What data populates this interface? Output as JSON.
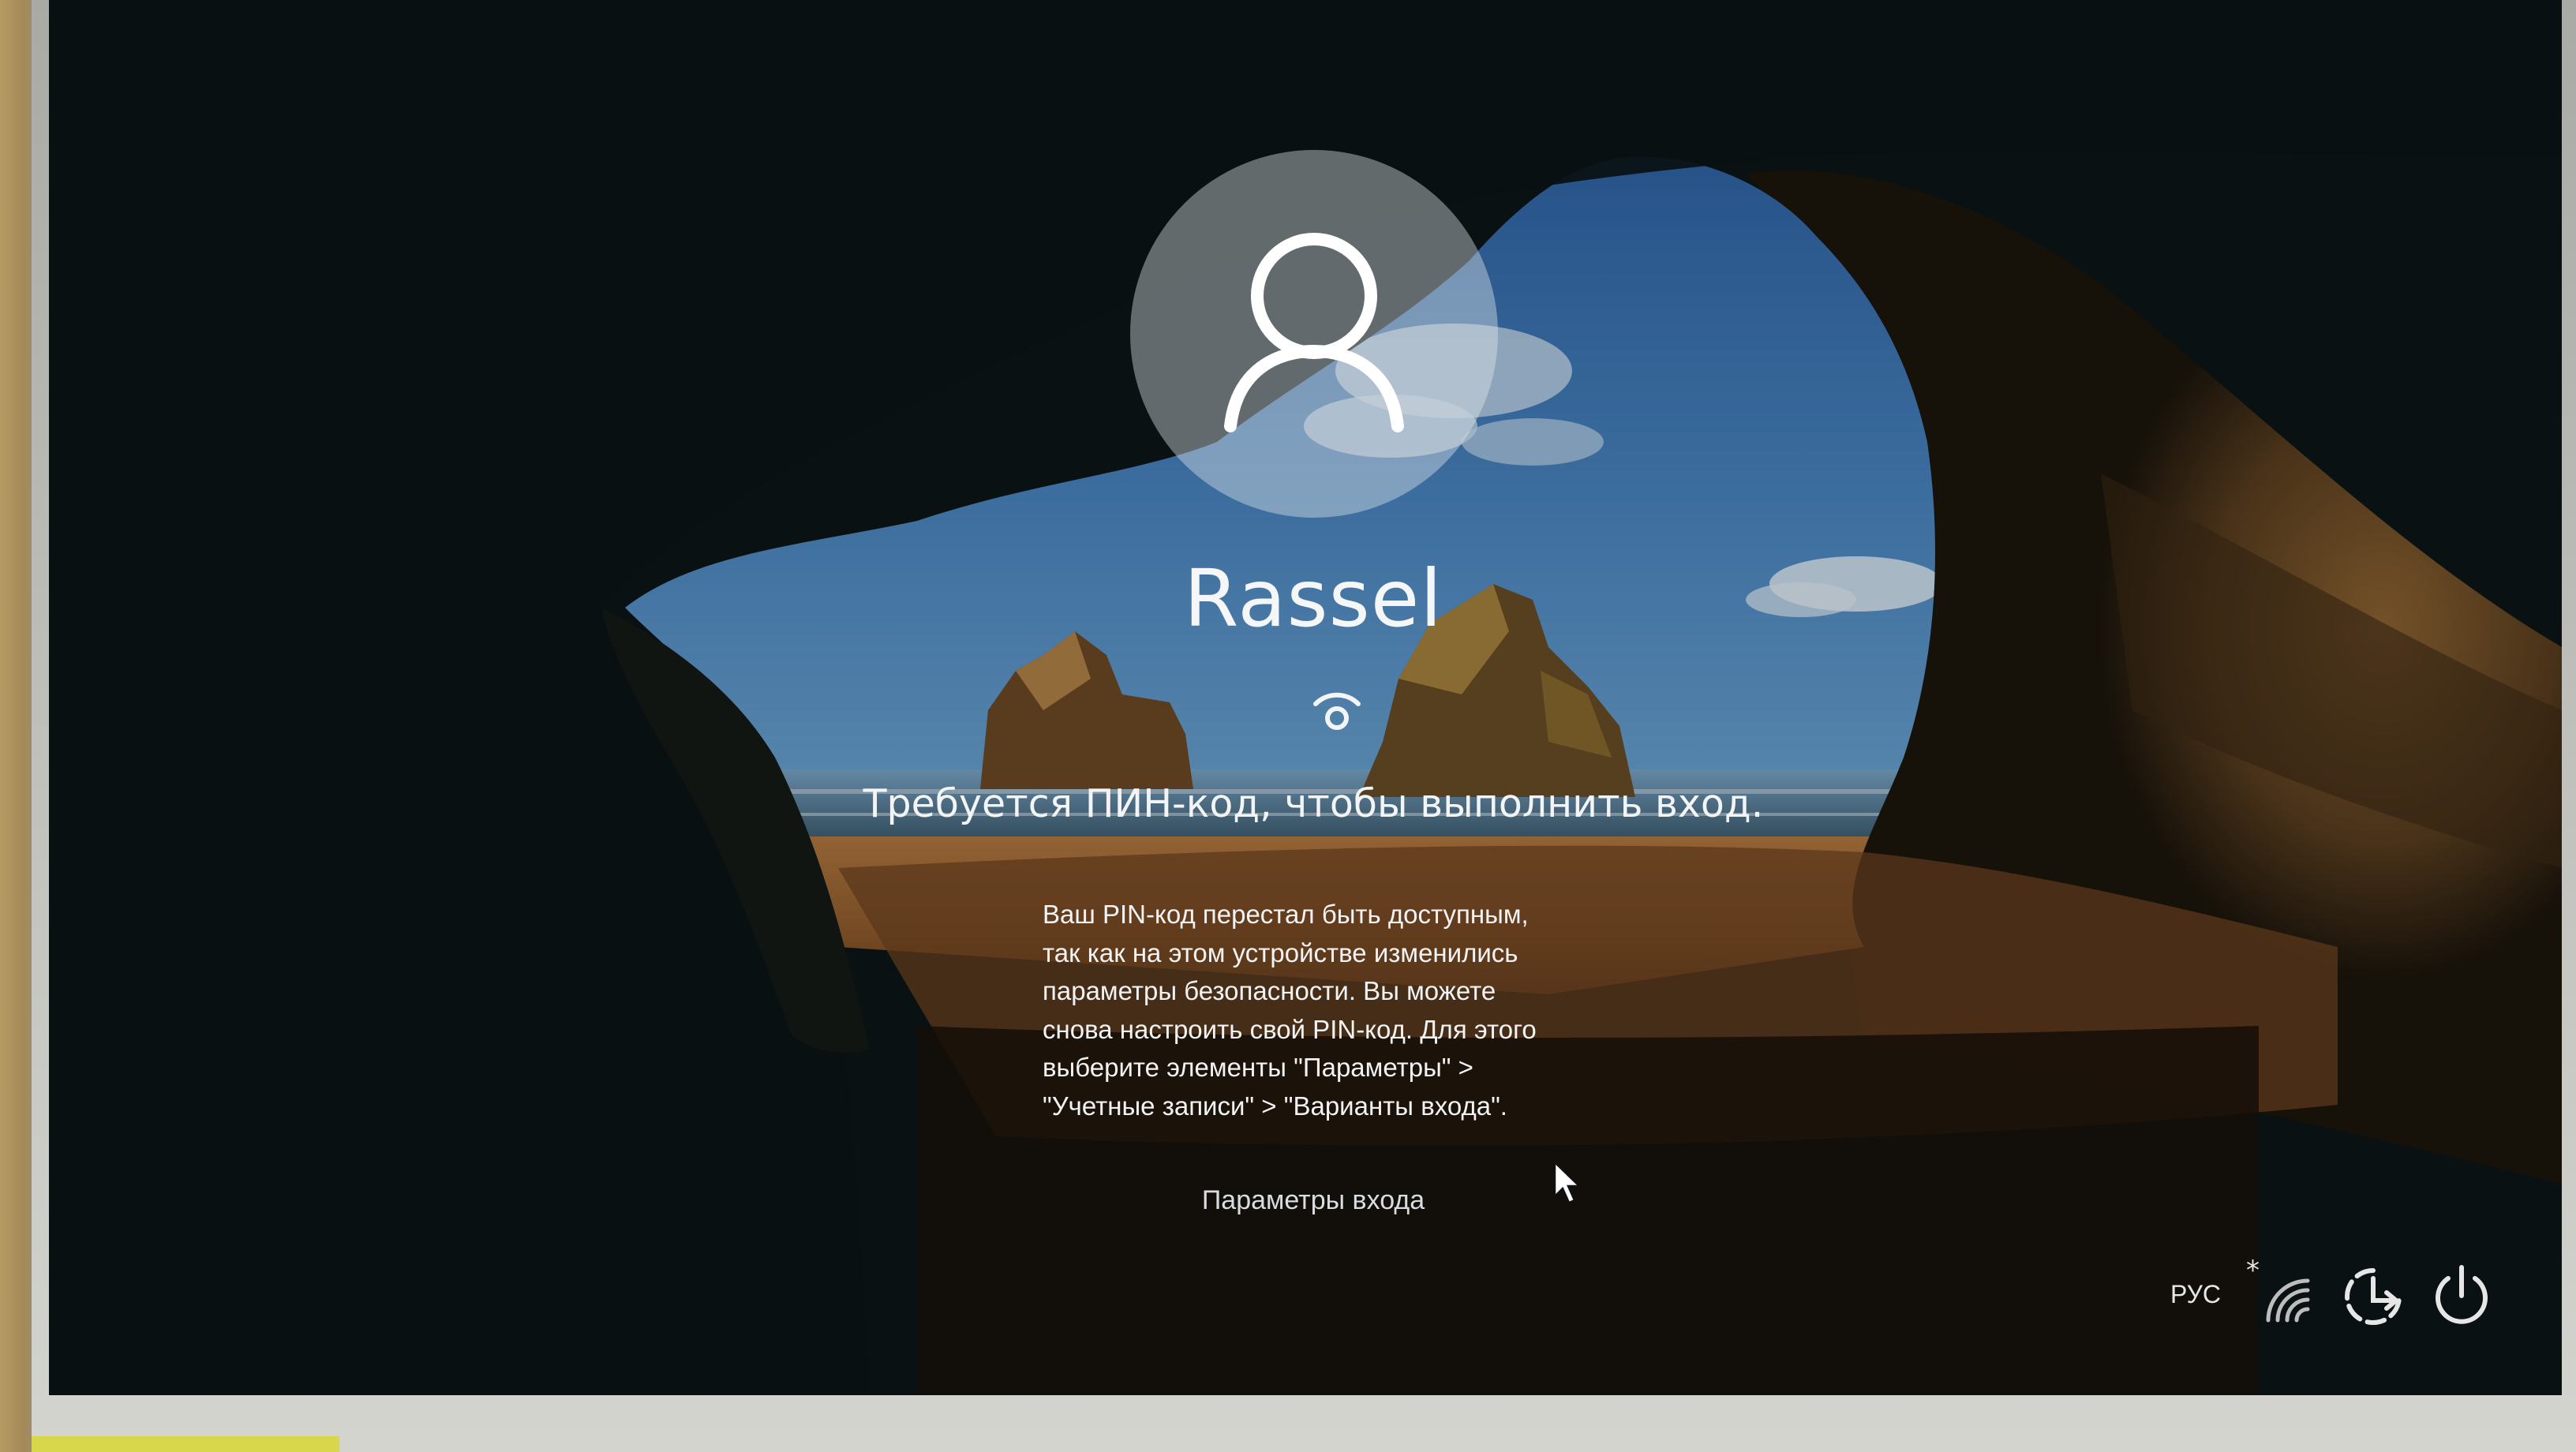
{
  "user": {
    "name": "Rassel"
  },
  "pin": {
    "heading": "Требуется ПИН-код, чтобы выполнить вход.",
    "message_lines": [
      "Ваш PIN-код перестал быть доступным,",
      "так как на этом устройстве изменились",
      "параметры безопасности. Вы можете",
      "снова настроить свой PIN-код. Для этого",
      "выберите элементы \"Параметры\" >",
      "\"Учетные записи\" > \"Варианты входа\"."
    ]
  },
  "sign_in_options": {
    "label": "Параметры входа"
  },
  "tray": {
    "language": "РУС",
    "icons": [
      "network-icon",
      "accessibility-icon",
      "power-icon"
    ]
  },
  "colors": {
    "text": "#f2f4f6",
    "avatar_circle": "#e1e8ec",
    "sky": "#3f77b4",
    "sand": "#9a6030",
    "cave": "#0b1516"
  }
}
